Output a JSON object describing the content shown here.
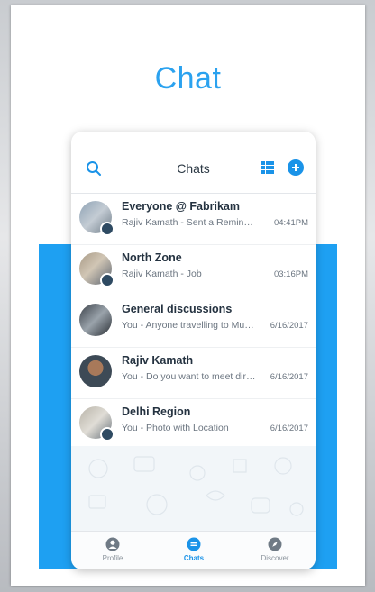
{
  "hero": {
    "title": "Chat"
  },
  "header": {
    "title": "Chats"
  },
  "chats": [
    {
      "title": "Everyone @ Fabrikam",
      "subtitle": "Rajiv Kamath - Sent a Reminder",
      "time": "04:41PM",
      "group": true
    },
    {
      "title": "North Zone",
      "subtitle": "Rajiv Kamath - Job",
      "time": "03:16PM",
      "group": true
    },
    {
      "title": "General discussions",
      "subtitle": "You - Anyone travelling to Mumbai...",
      "time": "6/16/2017",
      "group": false
    },
    {
      "title": "Rajiv Kamath",
      "subtitle": "You - Do you want to meet directly...",
      "time": "6/16/2017",
      "group": false
    },
    {
      "title": "Delhi Region",
      "subtitle": "You - Photo with Location",
      "time": "6/16/2017",
      "group": true
    }
  ],
  "tabs": [
    {
      "label": "Profile",
      "icon": "profile-icon",
      "active": false
    },
    {
      "label": "Chats",
      "icon": "chat-icon",
      "active": true
    },
    {
      "label": "Discover",
      "icon": "compass-icon",
      "active": false
    }
  ],
  "colors": {
    "accent": "#1a93e8",
    "band": "#1ea0f2",
    "title": "#2ba2ef"
  }
}
